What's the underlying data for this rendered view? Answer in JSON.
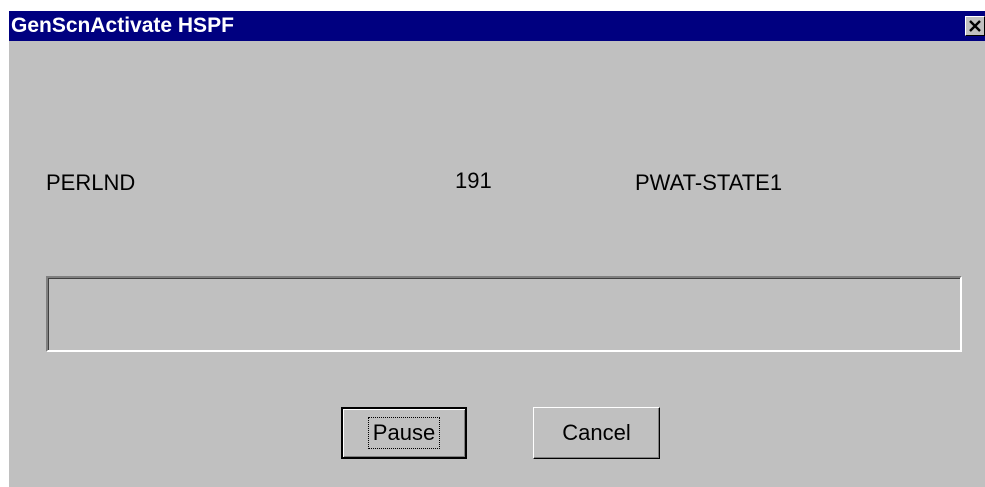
{
  "window": {
    "title": "GenScnActivate HSPF",
    "close_glyph": "×"
  },
  "status": {
    "operation": "PERLND",
    "id": "191",
    "section": "PWAT-STATE1"
  },
  "progress": {
    "fraction": 0.0
  },
  "buttons": {
    "pause_label": "Pause",
    "cancel_label": "Cancel"
  },
  "colors": {
    "titlebar": "#000080",
    "face": "#c0c0c0"
  }
}
